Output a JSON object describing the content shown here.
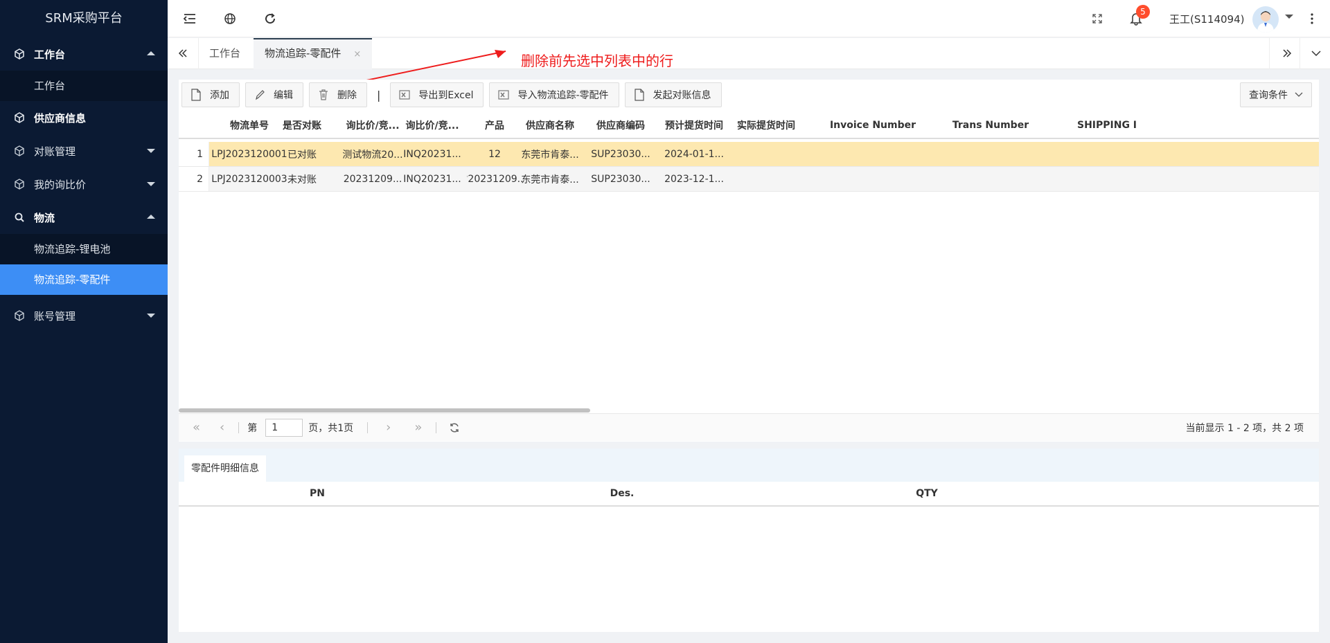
{
  "app": {
    "title": "SRM采购平台"
  },
  "sidebar": {
    "items": [
      {
        "label": "工作台",
        "expanded": true,
        "icon": "cube-icon",
        "children": [
          "工作台"
        ]
      },
      {
        "label": "供应商信息",
        "icon": "cube-icon"
      },
      {
        "label": "对账管理",
        "icon": "cube-icon"
      },
      {
        "label": "我的询比价",
        "icon": "cube-icon"
      },
      {
        "label": "物流",
        "expanded": true,
        "icon": "search-icon",
        "children": [
          "物流追踪-锂电池",
          "物流追踪-零配件"
        ]
      },
      {
        "label": "账号管理",
        "icon": "cube-icon"
      }
    ],
    "active_child": "物流追踪-零配件"
  },
  "header": {
    "notification_count": "5",
    "user": "王工(S114094)"
  },
  "tabs": [
    {
      "label": "工作台"
    },
    {
      "label": "物流追踪-零配件",
      "close": "×"
    }
  ],
  "annotation": "删除前先选中列表中的行",
  "toolbar": {
    "add": "添加",
    "edit": "编辑",
    "delete": "删除",
    "separator": "|",
    "export": "导出到Excel",
    "import": "导入物流追踪-零配件",
    "reconcile": "发起对账信息",
    "query": "查询条件"
  },
  "grid": {
    "columns": [
      "物流单号",
      "是否对账",
      "询比价/竞...",
      "询比价/竞...",
      "产品",
      "供应商名称",
      "供应商编码",
      "预计提货时间",
      "实际提货时间",
      "Invoice Number",
      "Trans Number",
      "SHIPPING I"
    ],
    "rows": [
      {
        "num": "1",
        "cells": [
          "LPJ2023120001",
          "已对账",
          "测试物流20...",
          "INQ20231...",
          "12",
          "东莞市肯泰...",
          "SUP23030...",
          "2024-01-1...",
          "",
          "",
          "",
          ""
        ]
      },
      {
        "num": "2",
        "cells": [
          "LPJ2023120003",
          "未对账",
          "20231209...",
          "INQ20231...",
          "?20231209...",
          "东莞市肯泰...",
          "SUP23030...",
          "2023-12-1...",
          "",
          "",
          "",
          ""
        ]
      }
    ]
  },
  "pager": {
    "page_label": "第",
    "page_value": "1",
    "page_suffix": "页，共1页",
    "info": "当前显示 1 - 2 项，共 2 项"
  },
  "detail": {
    "tab": "零配件明细信息",
    "columns": [
      "PN",
      "Des.",
      "QTY"
    ]
  },
  "colors": {
    "sidebar_bg": "#0b1a33",
    "active": "#3d8ef5",
    "selected_row": "#fde8b0",
    "annotation": "#ee1c1c",
    "badge": "#ff4d2d"
  }
}
